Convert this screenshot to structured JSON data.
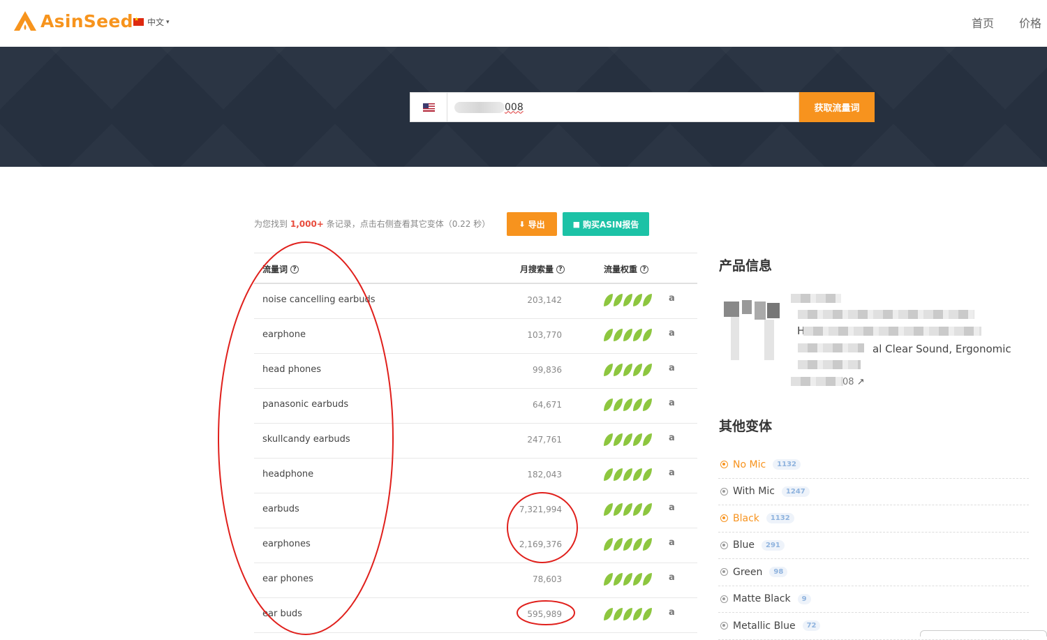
{
  "brand": {
    "name": "AsinSeed",
    "color": "#f7941d"
  },
  "header": {
    "language": "中文",
    "nav": [
      "首页",
      "价格"
    ]
  },
  "search": {
    "marketplace_icon": "us-flag-icon",
    "value_suffix": "008",
    "button_label": "获取流量词"
  },
  "summary": {
    "prefix": "为您找到",
    "count": "1,000+",
    "suffix": "条记录，点击右侧查看其它变体（0.22 秒）",
    "export_label": "导出",
    "report_label": "购买ASIN报告"
  },
  "table": {
    "headers": {
      "keyword": "流量词",
      "volume": "月搜索量",
      "weight": "流量权重"
    },
    "rows": [
      {
        "keyword": "noise cancelling earbuds",
        "volume": "203,142",
        "weight": 5
      },
      {
        "keyword": "earphone",
        "volume": "103,770",
        "weight": 5
      },
      {
        "keyword": "head phones",
        "volume": "99,836",
        "weight": 5
      },
      {
        "keyword": "panasonic earbuds",
        "volume": "64,671",
        "weight": 5
      },
      {
        "keyword": "skullcandy earbuds",
        "volume": "247,761",
        "weight": 5
      },
      {
        "keyword": "headphone",
        "volume": "182,043",
        "weight": 5
      },
      {
        "keyword": "earbuds",
        "volume": "7,321,994",
        "weight": 5
      },
      {
        "keyword": "earphones",
        "volume": "2,169,376",
        "weight": 5
      },
      {
        "keyword": "ear phones",
        "volume": "78,603",
        "weight": 5
      },
      {
        "keyword": "ear buds",
        "volume": "595,989",
        "weight": 5
      }
    ]
  },
  "product": {
    "title": "产品信息",
    "line_h": "H",
    "line_visible": "al Clear Sound, Ergonomic",
    "asin_suffix": "08"
  },
  "variants": {
    "title": "其他变体",
    "items": [
      {
        "label": "No Mic",
        "count": "1132",
        "active": true
      },
      {
        "label": "With Mic",
        "count": "1247",
        "active": false
      },
      {
        "label": "Black",
        "count": "1132",
        "active": true
      },
      {
        "label": "Blue",
        "count": "291",
        "active": false
      },
      {
        "label": "Green",
        "count": "98",
        "active": false
      },
      {
        "label": "Matte Black",
        "count": "9",
        "active": false
      },
      {
        "label": "Metallic Blue",
        "count": "72",
        "active": false
      }
    ]
  },
  "colors": {
    "accent": "#f7931e",
    "teal": "#1cc2a6",
    "leaf": "#8dc63f",
    "annotation": "#e0201c",
    "highlight": "#e84c3d"
  }
}
